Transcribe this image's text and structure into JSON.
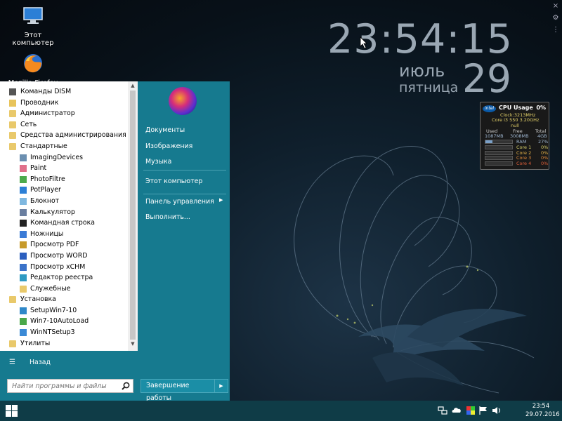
{
  "desktop": {
    "icons": [
      {
        "label": "Этот компьютер",
        "icon": "monitor-icon"
      },
      {
        "label": "Mozilla Firefox",
        "icon": "firefox-icon"
      }
    ]
  },
  "clock": {
    "time": "23:54:15",
    "month": "июль",
    "weekday": "пятница",
    "day": "29",
    "color": "#9aa7b3"
  },
  "cpu_gadget": {
    "title": "CPU Usage",
    "total_percent": "0%",
    "clock": "Clock:3213MHz",
    "model": "Core i3 550 3.20GHz",
    "extra": "null",
    "headers": [
      "Used",
      "Free",
      "Total"
    ],
    "memory": {
      "used": "1087MB",
      "free": "3008MB",
      "total": "4GB"
    },
    "ram": {
      "label": "RAM",
      "percent": "27%",
      "fill": 0.27
    },
    "cores": [
      {
        "label": "Core 1",
        "percent": "0%",
        "fill": 0
      },
      {
        "label": "Core 2",
        "percent": "0%",
        "fill": 0
      },
      {
        "label": "Core 3",
        "percent": "0%",
        "fill": 0
      },
      {
        "label": "Core 4",
        "percent": "0%",
        "fill": 0
      }
    ],
    "core_colors": [
      "#d8d06a",
      "#e7b44a",
      "#e28c3b",
      "#e0603a"
    ]
  },
  "start_menu": {
    "accent_color": "#167a8f",
    "programs": [
      {
        "label": "Команды DISM",
        "icon": "console-icon",
        "level": 0
      },
      {
        "label": "Проводник",
        "icon": "explorer-icon",
        "level": 0
      },
      {
        "label": "Администратор",
        "icon": "folder-icon",
        "level": 0
      },
      {
        "label": "Сеть",
        "icon": "folder-icon",
        "level": 0
      },
      {
        "label": "Средства администрирования Windows",
        "icon": "folder-icon",
        "level": 0
      },
      {
        "label": "Стандартные",
        "icon": "folder-icon",
        "level": 0
      },
      {
        "label": "ImagingDevices",
        "icon": "scanner-icon",
        "level": 1
      },
      {
        "label": "Paint",
        "icon": "paint-icon",
        "level": 1
      },
      {
        "label": "PhotoFiltre",
        "icon": "photofiltre-icon",
        "level": 1
      },
      {
        "label": "PotPlayer",
        "icon": "play-icon",
        "level": 1
      },
      {
        "label": "Блокнот",
        "icon": "notepad-icon",
        "level": 1
      },
      {
        "label": "Калькулятор",
        "icon": "calculator-icon",
        "level": 1
      },
      {
        "label": "Командная строка",
        "icon": "cmd-icon",
        "level": 1
      },
      {
        "label": "Ножницы",
        "icon": "scissors-icon",
        "level": 1
      },
      {
        "label": "Просмотр PDF",
        "icon": "pdf-icon",
        "level": 1
      },
      {
        "label": "Просмотр WORD",
        "icon": "word-viewer-icon",
        "level": 1
      },
      {
        "label": "Просмотр xCHM",
        "icon": "chm-icon",
        "level": 1
      },
      {
        "label": "Редактор реестра",
        "icon": "regedit-icon",
        "level": 1
      },
      {
        "label": "Служебные",
        "icon": "folder-icon",
        "level": 1
      },
      {
        "label": "Установка",
        "icon": "folder-icon",
        "level": 0
      },
      {
        "label": "SetupWin7-10",
        "icon": "setup-icon",
        "level": 1
      },
      {
        "label": "Win7-10AutoLoad",
        "icon": "autoload-icon",
        "level": 1
      },
      {
        "label": "WinNTSetup3",
        "icon": "winntsetup-icon",
        "level": 1
      },
      {
        "label": "Утилиты",
        "icon": "folder-icon",
        "level": 0
      }
    ],
    "back_label": "Назад",
    "search_placeholder": "Найти программы и файлы",
    "right_links": [
      {
        "label": "Документы"
      },
      {
        "label": "Изображения"
      },
      {
        "label": "Музыка"
      },
      {
        "label": "Этот компьютер"
      },
      {
        "label": "Панель управления"
      },
      {
        "label": "Выполнить..."
      }
    ],
    "shutdown_label": "Завершение работы"
  },
  "taskbar": {
    "time": "23:54",
    "date": "29.07.2016",
    "tray_icons": [
      "network-icon",
      "cloud-icon",
      "color-icon",
      "flag-icon",
      "volume-icon"
    ]
  }
}
